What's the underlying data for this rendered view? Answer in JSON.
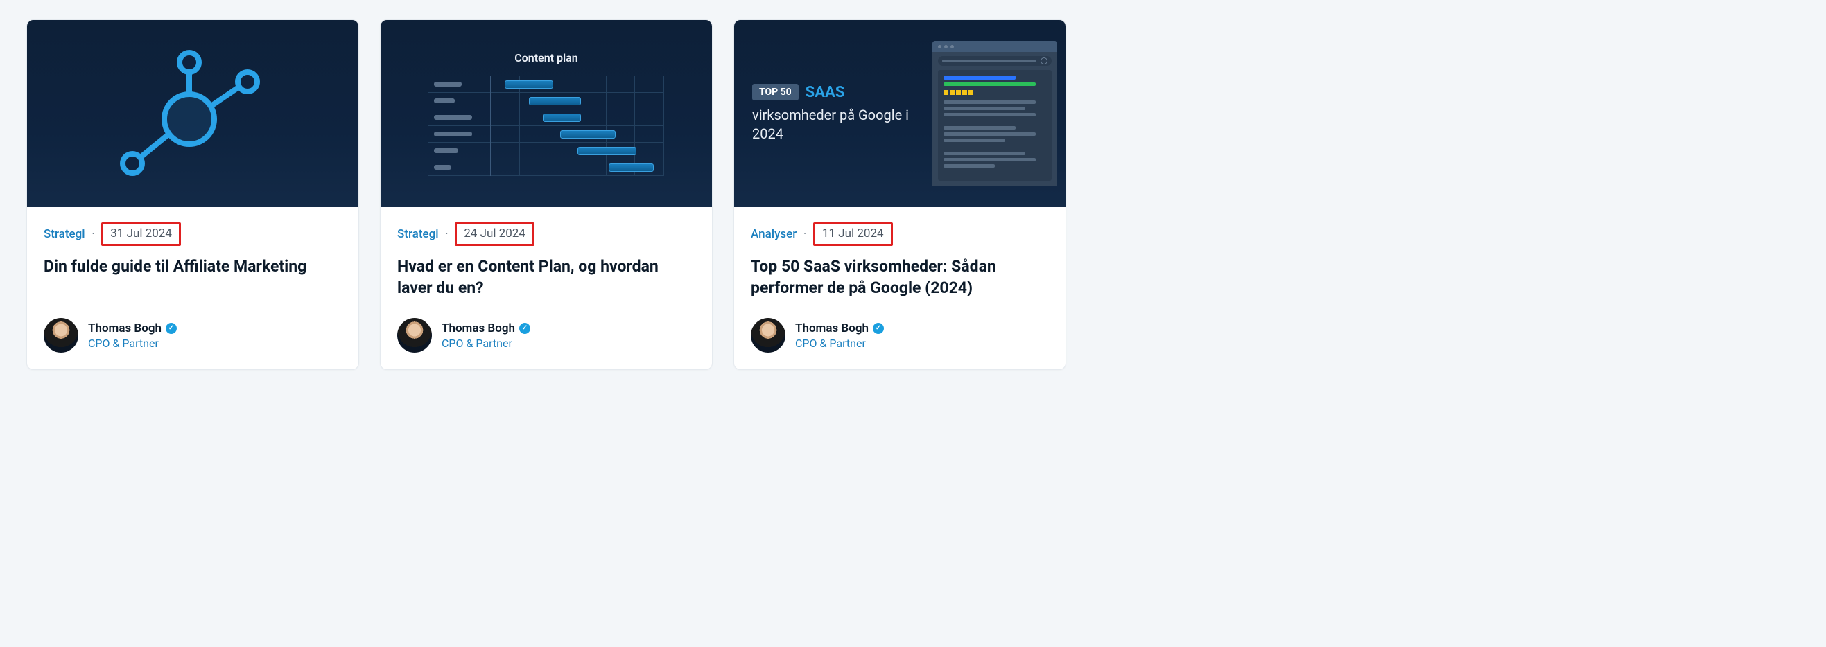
{
  "cards": [
    {
      "category": "Strategi",
      "date": "31 Jul 2024",
      "title": "Din fulde guide til Affiliate Marketing",
      "author_name": "Thomas Bogh",
      "author_role": "CPO & Partner"
    },
    {
      "category": "Strategi",
      "date": "24 Jul 2024",
      "title": "Hvad er en Content Plan, og hvordan laver du en?",
      "thumb_title": "Content plan",
      "author_name": "Thomas Bogh",
      "author_role": "CPO & Partner"
    },
    {
      "category": "Analyser",
      "date": "11 Jul 2024",
      "title": "Top 50 SaaS virksomheder: Sådan performer de på Google (2024)",
      "thumb_badge": "TOP 50",
      "thumb_saas": "SAAS",
      "thumb_sub": "virksomheder på Google i 2024",
      "author_name": "Thomas Bogh",
      "author_role": "CPO & Partner"
    }
  ]
}
